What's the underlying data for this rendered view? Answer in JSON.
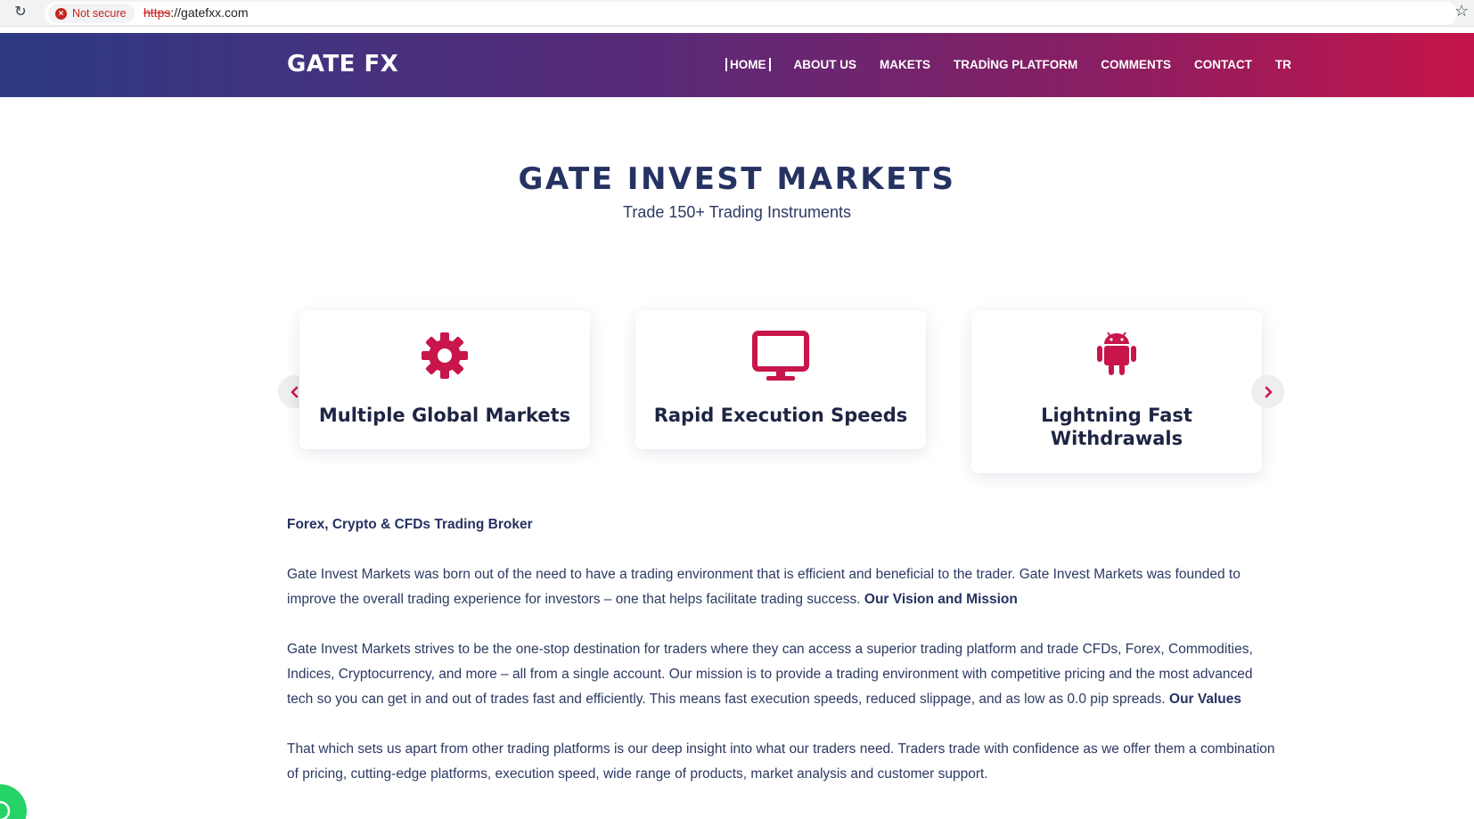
{
  "browser": {
    "security_label": "Not secure",
    "url_scheme": "https",
    "url_rest": "://gatefxx.com"
  },
  "header": {
    "logo_text": "GATE FX",
    "nav": [
      {
        "label": "HOME",
        "active": true
      },
      {
        "label": "ABOUT US"
      },
      {
        "label": "MAKETS"
      },
      {
        "label": "TRADİNG PLATFORM"
      },
      {
        "label": "COMMENTS"
      },
      {
        "label": "CONTACT"
      },
      {
        "label": "TR"
      }
    ]
  },
  "hero": {
    "title": "GATE INVEST MARKETS",
    "subtitle": "Trade 150+ Trading Instruments"
  },
  "carousel": {
    "cards": [
      {
        "title": "Multiple Global Markets",
        "icon": "gear-icon"
      },
      {
        "title": "Rapid Execution Speeds",
        "icon": "desktop-icon"
      },
      {
        "title": "Lightning Fast Withdrawals",
        "icon": "android-icon"
      }
    ]
  },
  "content": {
    "lead": "Forex, Crypto & CFDs Trading Broker",
    "p1": "Gate Invest Markets was born out of the need to have a trading environment that is efficient and beneficial to the trader. Gate Invest Markets was founded to improve the overall trading experience for investors – one that helps facilitate trading success.",
    "p1_link": "Our Vision and Mission",
    "p2": "Gate Invest Markets strives to be the one-stop destination for traders where they can access a superior trading platform and trade CFDs, Forex, Commodities, Indices, Cryptocurrency, and more – all from a single account. Our mission is to provide a trading environment with competitive pricing and the most advanced tech so you can get in and out of trades fast and efficiently. This means fast execution speeds, reduced slippage, and as low as 0.0 pip spreads.",
    "p2_link": "Our Values",
    "p3": "That which sets us apart from other trading platforms is our deep insight into what our traders need. Traders trade with confidence as we offer them a combination of pricing, cutting-edge platforms, execution speed, wide range of products, market analysis and customer support."
  },
  "colors": {
    "accent": "#c8154a",
    "navy": "#253262",
    "header_gradient_start": "#2e3a84",
    "header_gradient_end": "#c5154a"
  }
}
